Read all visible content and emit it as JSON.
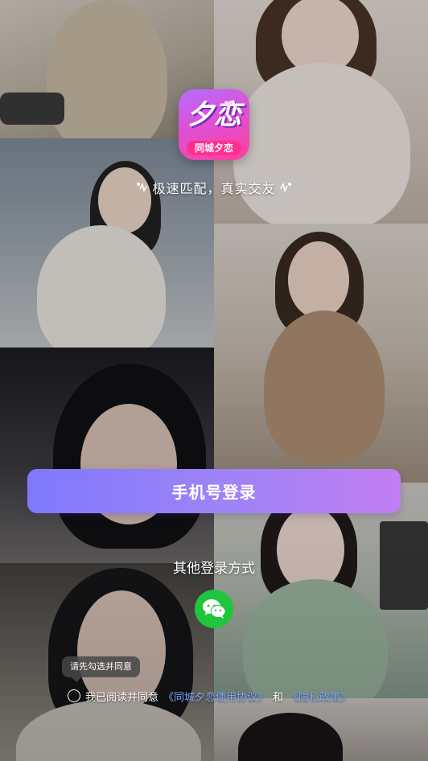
{
  "brand": {
    "logo_main": "夕恋",
    "logo_sub": "同城夕恋"
  },
  "slogan": "极速匹配，真实交友",
  "login": {
    "phone_button": "手机号登录",
    "other_methods_label": "其他登录方式",
    "wechat_icon": "wechat-icon"
  },
  "agreement": {
    "tooltip": "请先勾选并同意",
    "prefix": "我已阅读并同意",
    "user_agreement": "《同城夕恋使用协议》",
    "conjunction": "和",
    "privacy_policy": "《隐私政策》",
    "checked": false
  },
  "colors": {
    "button_gradient_start": "#7f79fd",
    "button_gradient_end": "#c17ef2",
    "wechat_green": "#1fc53d",
    "link_blue": "#7fa8ff",
    "logo_pink": "#ff2f8e"
  }
}
